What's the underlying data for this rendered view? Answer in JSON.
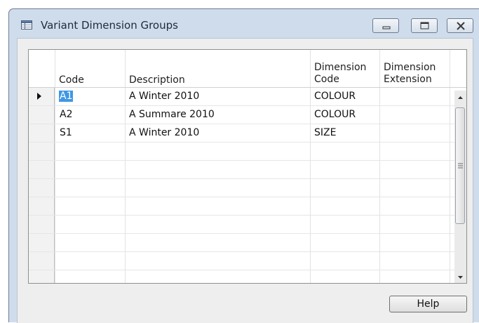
{
  "window": {
    "title": "Variant Dimension Groups",
    "controls": [
      "minimize",
      "maximize",
      "close"
    ]
  },
  "grid": {
    "columns": [
      {
        "key": "code",
        "label": "Code"
      },
      {
        "key": "description",
        "label": "Description"
      },
      {
        "key": "dimension_code",
        "label_line1": "Dimension",
        "label_line2": "Code"
      },
      {
        "key": "dimension_extension",
        "label_line1": "Dimension",
        "label_line2": "Extension"
      }
    ],
    "rows": [
      {
        "code": "A1",
        "description": "A Winter 2010",
        "dimension_code": "COLOUR",
        "dimension_extension": "",
        "selected": true
      },
      {
        "code": "A2",
        "description": "A Summare 2010",
        "dimension_code": "COLOUR",
        "dimension_extension": ""
      },
      {
        "code": "S1",
        "description": "A Winter 2010",
        "dimension_code": "SIZE",
        "dimension_extension": ""
      }
    ],
    "empty_rows": 7
  },
  "buttons": {
    "help": "Help"
  },
  "colors": {
    "selection": "#3f97e5",
    "window_frame": "#cfdcec",
    "client_bg": "#eeeeee"
  },
  "icons": [
    "table-icon",
    "minimize-icon",
    "maximize-icon",
    "close-icon",
    "scroll-up-arrow-icon",
    "scroll-down-arrow-icon",
    "row-pointer-icon"
  ]
}
